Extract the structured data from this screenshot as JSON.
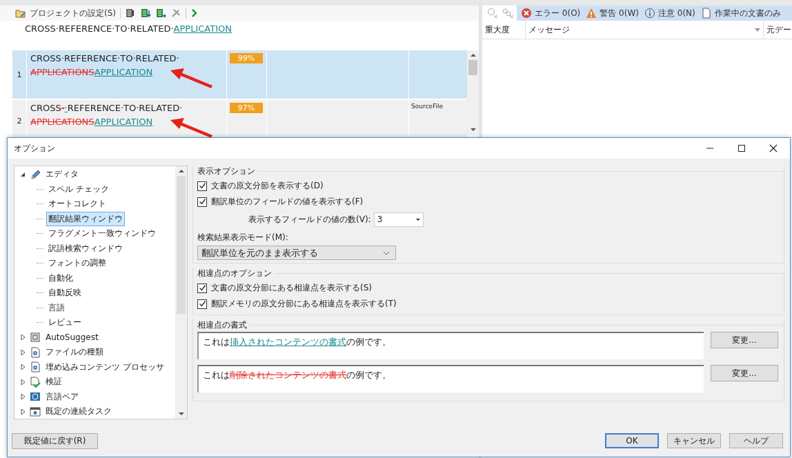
{
  "project_toolbar": {
    "settings_button": "プロジェクトの設定(S)"
  },
  "preview": [
    {
      "kind": "plain",
      "text": "CROSS·REFERENCE·TO·RELATED·"
    },
    {
      "kind": "inserted",
      "text": "APPLICATION"
    }
  ],
  "matches": [
    {
      "number": "1",
      "selected": true,
      "marked": true,
      "score": "99%",
      "lines": [
        [
          {
            "kind": "plain",
            "text": "CROSS·REFERENCE·TO·RELATED·"
          }
        ],
        [
          {
            "kind": "deleted",
            "text": "APPLICATIONS"
          },
          {
            "kind": "inserted",
            "text": "APPLICATION"
          }
        ]
      ]
    },
    {
      "number": "2",
      "selected": false,
      "marked": true,
      "score": "97%",
      "column_4": "SourceFile",
      "lines": [
        [
          {
            "kind": "plain",
            "text": "CROSS"
          },
          {
            "kind": "deleted",
            "text": "-"
          },
          {
            "kind": "inserted",
            "text": "·"
          },
          {
            "kind": "plain",
            "text": "REFERENCE·TO·RELATED·"
          }
        ],
        [
          {
            "kind": "deleted",
            "text": "APPLICATIONS"
          },
          {
            "kind": "inserted",
            "text": "APPLICATION"
          }
        ]
      ]
    }
  ],
  "messages_toolbar": {
    "filters": [
      {
        "kind": "error",
        "label": "エラー 0(O)"
      },
      {
        "kind": "warning",
        "label": "警告 0(W)"
      },
      {
        "kind": "info",
        "label": "注意 0(N)"
      },
      {
        "kind": "document",
        "label": "作業中の文書のみ"
      }
    ]
  },
  "messages_table": {
    "columns": [
      "重大度",
      "メッセージ",
      "元デー"
    ]
  },
  "dialog": {
    "title": "オプション",
    "tree": [
      {
        "label": "エディタ",
        "kind": "editor",
        "expanded": true,
        "selected": false,
        "children": [
          {
            "label": "スペル チェック",
            "selected": false
          },
          {
            "label": "オートコレクト",
            "selected": false
          },
          {
            "label": "翻訳結果ウィンドウ",
            "selected": true
          },
          {
            "label": "フラグメント一致ウィンドウ",
            "selected": false
          },
          {
            "label": "訳語検索ウィンドウ",
            "selected": false
          },
          {
            "label": "フォントの調整",
            "selected": false
          },
          {
            "label": "自動化",
            "selected": false
          },
          {
            "label": "自動反映",
            "selected": false
          },
          {
            "label": "言語",
            "selected": false
          },
          {
            "label": "レビュー",
            "selected": false
          }
        ]
      },
      {
        "label": "AutoSuggest",
        "kind": "module",
        "expanded": false,
        "selected": false
      },
      {
        "label": "ファイルの種類",
        "kind": "settings",
        "expanded": false,
        "selected": false
      },
      {
        "label": "埋め込みコンテンツ プロセッサ",
        "kind": "settings",
        "expanded": false,
        "selected": false
      },
      {
        "label": "検証",
        "kind": "verification",
        "expanded": false,
        "selected": false
      },
      {
        "label": "言語ペア",
        "kind": "language",
        "expanded": false,
        "selected": false
      },
      {
        "label": "既定の連続タスク",
        "kind": "task",
        "expanded": false,
        "selected": false
      }
    ],
    "display_options": {
      "title": "表示オプション",
      "checkboxes": [
        {
          "label": "文書の原文分節を表示する(D)",
          "checked": true
        },
        {
          "label": "翻訳単位のフィールドの値を表示する(F)",
          "checked": true
        }
      ],
      "field_count": {
        "label": "表示するフィールドの値の数(V):",
        "value": "3"
      },
      "search_mode": {
        "label": "検索結果表示モード(M):",
        "value": "翻訳単位を元のまま表示する"
      }
    },
    "difference_options": {
      "title": "相違点のオプション",
      "checkboxes": [
        {
          "label": "文書の原文分節にある相違点を表示する(S)",
          "checked": true
        },
        {
          "label": "翻訳メモリの原文分節にある相違点を表示する(T)",
          "checked": true
        }
      ]
    },
    "difference_format": {
      "title": "相違点の書式",
      "samples": [
        {
          "segments": [
            {
              "kind": "plain",
              "text": "これは"
            },
            {
              "kind": "inserted",
              "text": "挿入されたコンテンツの書式"
            },
            {
              "kind": "plain",
              "text": "の例です。"
            }
          ],
          "button": "変更..."
        },
        {
          "segments": [
            {
              "kind": "plain",
              "text": "これは"
            },
            {
              "kind": "deleted",
              "text": "削除されたコンテンツの書式"
            },
            {
              "kind": "plain",
              "text": "の例です。"
            }
          ],
          "button": "変更..."
        }
      ]
    },
    "reset_button": "既定値に戻す(R)",
    "buttons": [
      {
        "label": "OK",
        "default": true
      },
      {
        "label": "キャンセル",
        "default": false
      },
      {
        "label": "ヘルプ",
        "default": false
      }
    ]
  }
}
